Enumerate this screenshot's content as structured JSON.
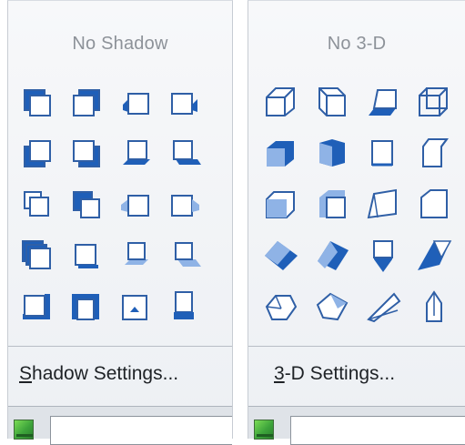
{
  "shadow_panel": {
    "title": "No Shadow",
    "settings_mnemonic": "S",
    "settings_rest": "hadow Settings...",
    "swatch_color": "#4cbb3f"
  },
  "threed_panel": {
    "title": "No 3-D",
    "settings_mnemonic": "3",
    "settings_rest": "-D Settings...",
    "swatch_color": "#4cbb3f"
  },
  "colors": {
    "accent_blue": "#1f5fb8",
    "light_blue": "#8fb3e6",
    "outline_blue": "#2f5fa6"
  },
  "shadow_styles": [
    "shadow-style-1",
    "shadow-style-2",
    "shadow-style-3",
    "shadow-style-4",
    "shadow-style-5",
    "shadow-style-6",
    "shadow-style-7",
    "shadow-style-8",
    "shadow-style-9",
    "shadow-style-10",
    "shadow-style-11",
    "shadow-style-12",
    "shadow-style-13",
    "shadow-style-14",
    "shadow-style-15",
    "shadow-style-16",
    "shadow-style-17",
    "shadow-style-18",
    "shadow-style-19",
    "shadow-style-20"
  ],
  "threed_styles": [
    "3d-style-1",
    "3d-style-2",
    "3d-style-3",
    "3d-style-4",
    "3d-style-5",
    "3d-style-6",
    "3d-style-7",
    "3d-style-8",
    "3d-style-9",
    "3d-style-10",
    "3d-style-11",
    "3d-style-12",
    "3d-style-13",
    "3d-style-14",
    "3d-style-15",
    "3d-style-16",
    "3d-style-17",
    "3d-style-18",
    "3d-style-19",
    "3d-style-20"
  ]
}
